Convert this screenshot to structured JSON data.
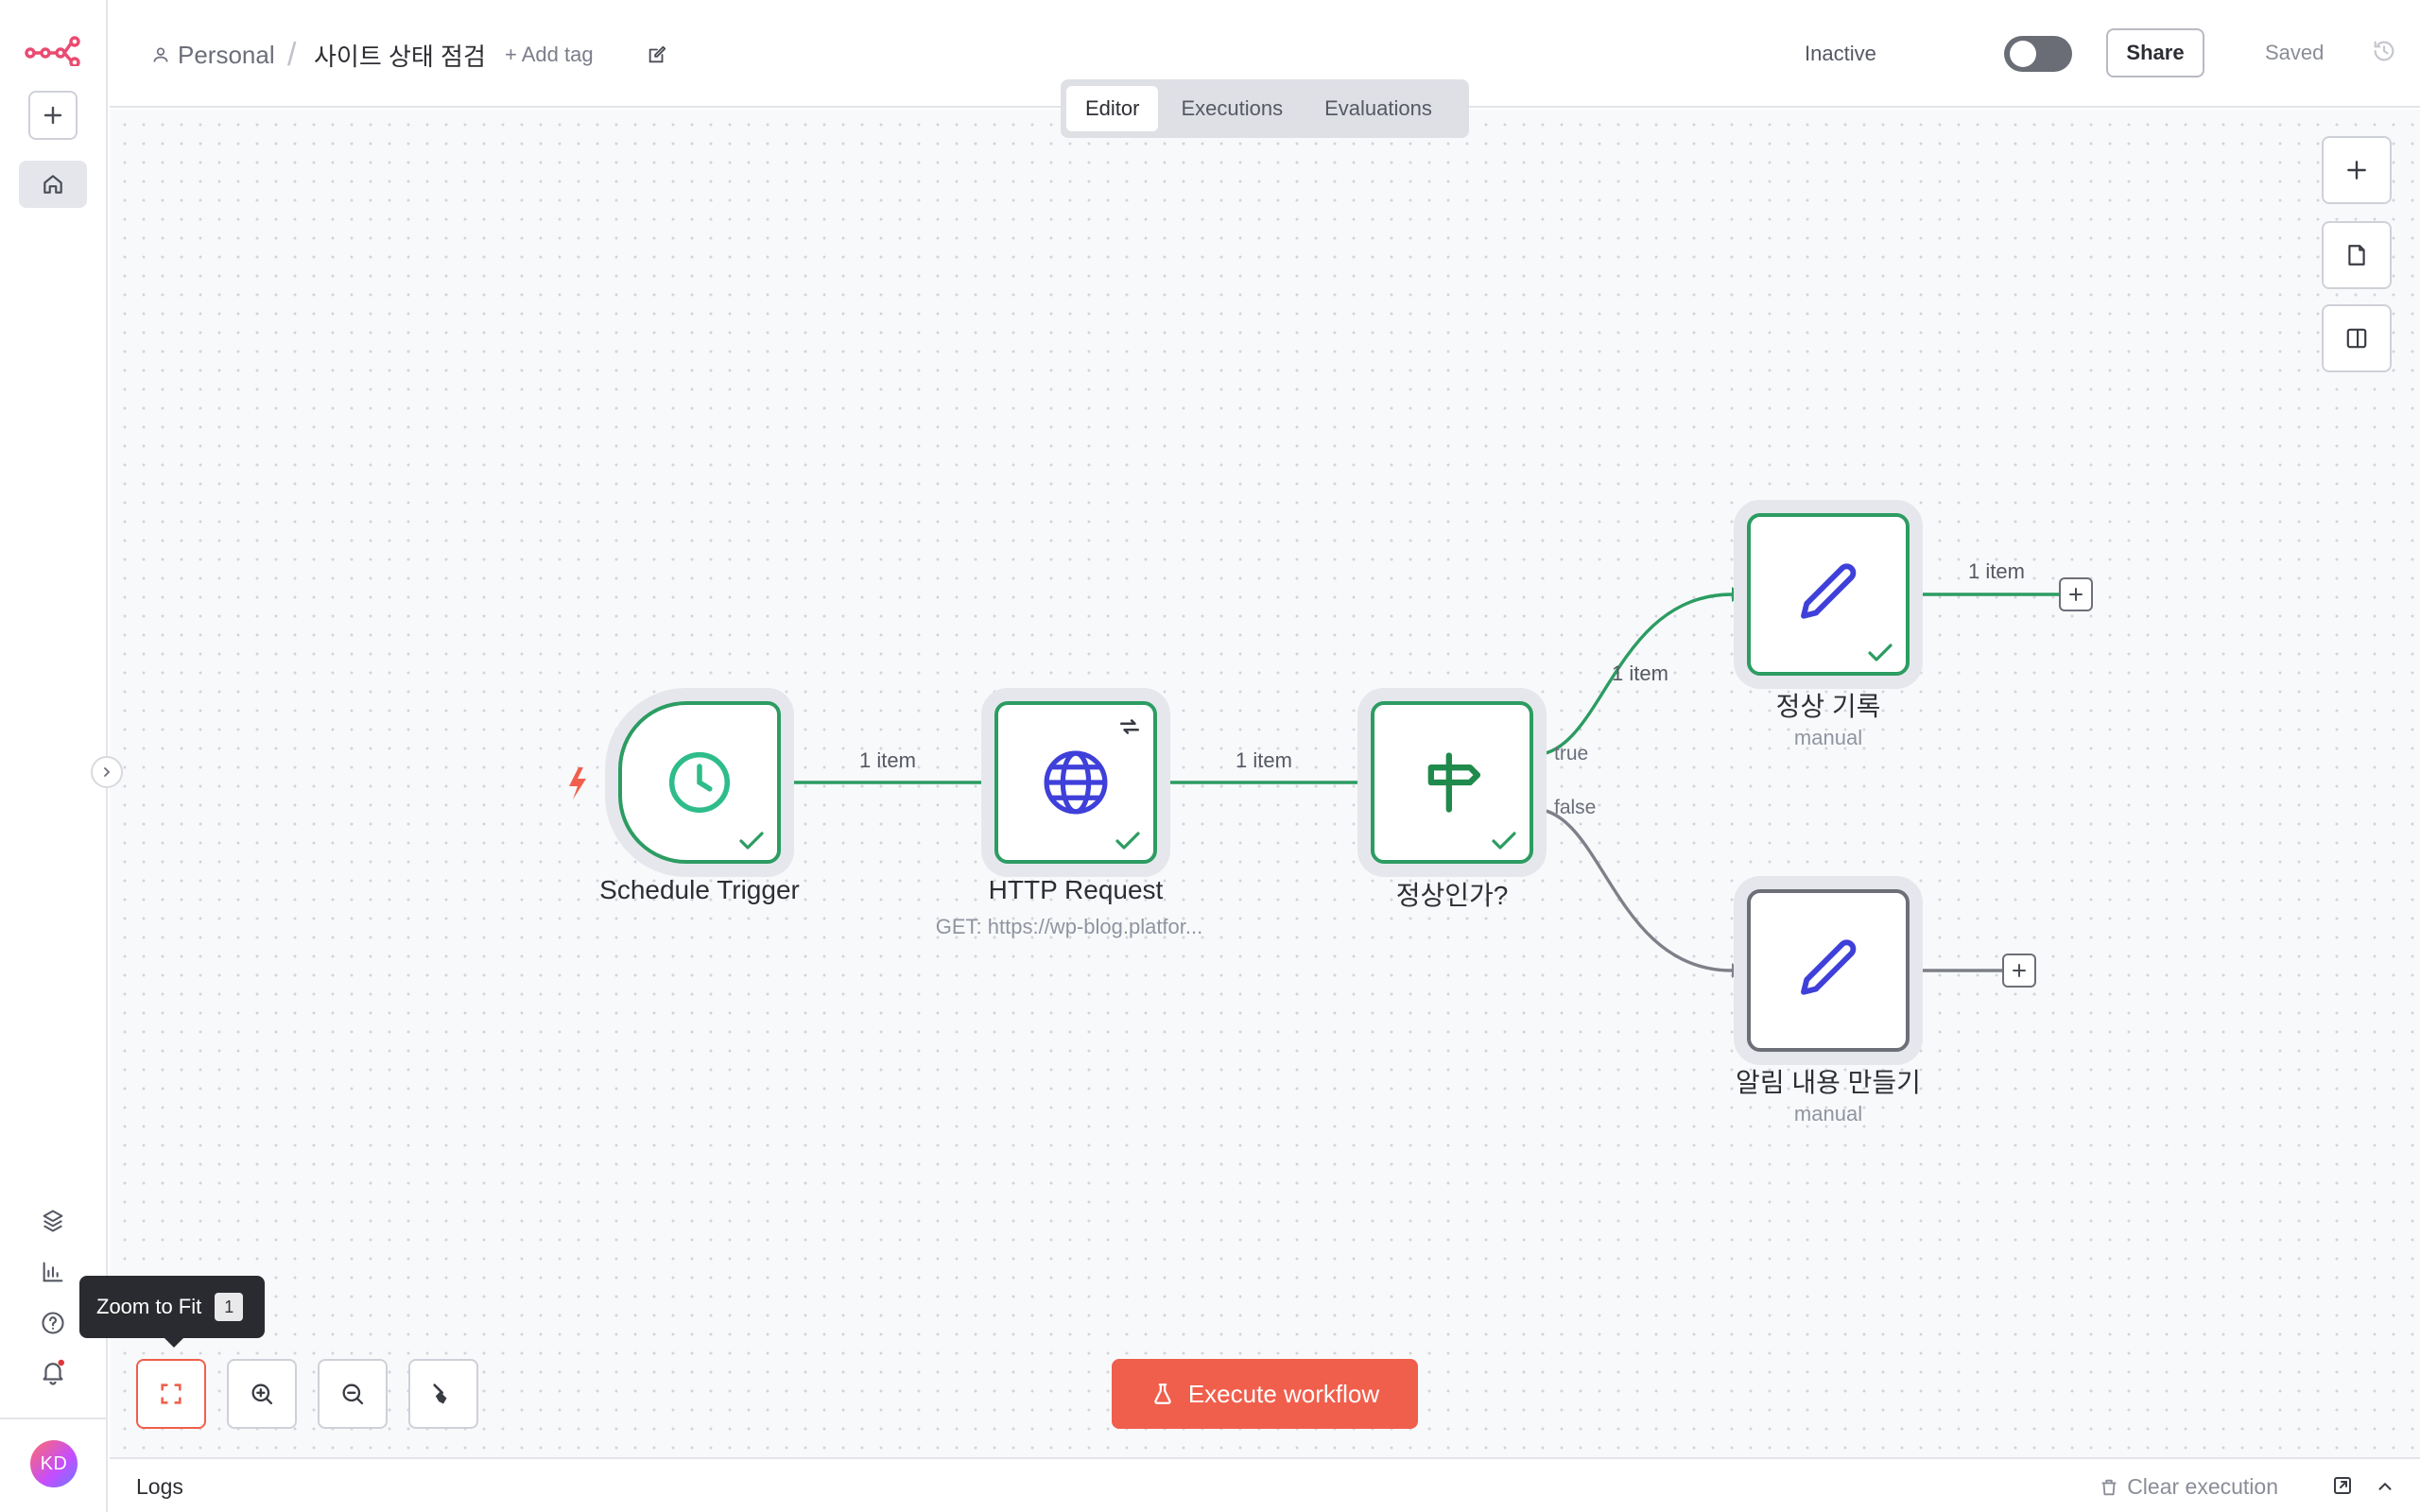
{
  "header": {
    "breadcrumb_owner": "Personal",
    "breadcrumb_sep": "/",
    "workflow_title": "사이트 상태 점검",
    "add_tag": "+ Add tag",
    "status_label": "Inactive",
    "share_label": "Share",
    "saved_label": "Saved"
  },
  "tabs": [
    {
      "label": "Editor",
      "active": true
    },
    {
      "label": "Executions",
      "active": false
    },
    {
      "label": "Evaluations",
      "active": false
    }
  ],
  "nodes": {
    "schedule": {
      "label": "Schedule Trigger"
    },
    "http": {
      "label": "HTTP Request",
      "subtitle": "GET: https://wp-blog.platfor..."
    },
    "if": {
      "label": "정상인가?",
      "true_label": "true",
      "false_label": "false"
    },
    "normal": {
      "label": "정상 기록",
      "subtitle": "manual"
    },
    "alert": {
      "label": "알림 내용 만들기",
      "subtitle": "manual"
    }
  },
  "edges": {
    "e1": "1 item",
    "e2": "1 item",
    "e3": "1 item",
    "e4": "1 item"
  },
  "controls": {
    "tooltip_label": "Zoom to Fit",
    "tooltip_key": "1",
    "execute_label": "Execute workflow"
  },
  "logs": {
    "label": "Logs",
    "clear_label": "Clear execution"
  },
  "user": {
    "initials": "KD"
  },
  "colors": {
    "accent": "#f05f4c",
    "success": "#2c9c62",
    "brand": "#ea4b71",
    "icon_blue": "#3f3fd9"
  }
}
